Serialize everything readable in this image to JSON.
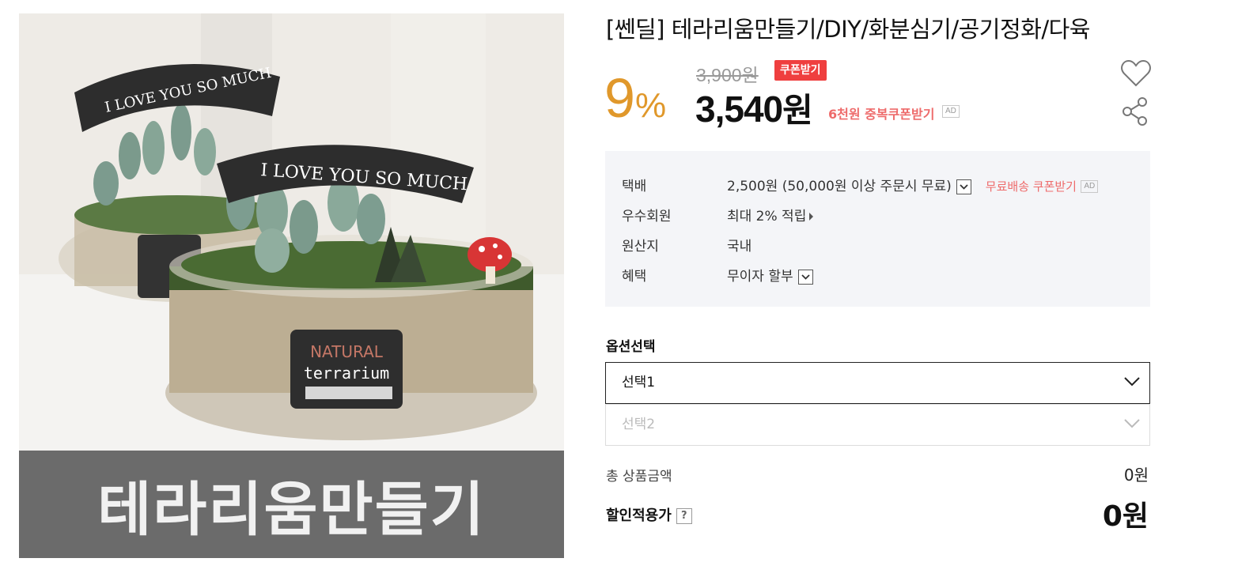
{
  "image": {
    "banner_text": "테라리움만들기",
    "ribbon_text": "I LOVE YOU SO MUCH",
    "label_line1": "NATURAL",
    "label_line2": "terrarium"
  },
  "product": {
    "title": "[쎈딜] 테라리움만들기/DIY/화분심기/공기정화/다육"
  },
  "price": {
    "discount_rate": "9",
    "discount_unit": "%",
    "original_price": "3,900원",
    "coupon_badge": "쿠폰받기",
    "sale_amount": "3,540",
    "sale_unit": "원",
    "coupon_text": "6천원 중복쿠폰받기",
    "ad_label": "AD"
  },
  "info": {
    "rows": [
      {
        "label": "택배",
        "value": "2,500원 (50,000원 이상 주문시 무료)",
        "extra": "무료배송 쿠폰받기",
        "extra_ad": "AD"
      },
      {
        "label": "우수회원",
        "value": "최대 2% 적립"
      },
      {
        "label": "원산지",
        "value": "국내"
      },
      {
        "label": "혜택",
        "value": "무이자 할부"
      }
    ]
  },
  "options": {
    "heading": "옵션선택",
    "select1": "선택1",
    "select2": "선택2"
  },
  "summary": {
    "total_label": "총 상품금액",
    "total_value": "0원",
    "discount_label": "할인적용가",
    "help_symbol": "?",
    "discount_value": "0원"
  },
  "colors": {
    "discount_orange": "#e0982b",
    "coupon_red": "#ef3f3f",
    "coupon_text_red": "#ee6b6b",
    "info_bg": "#f4f5f8"
  },
  "icons": [
    "heart-icon",
    "share-icon",
    "chevron-down-icon",
    "arrow-right-icon",
    "help-icon"
  ]
}
